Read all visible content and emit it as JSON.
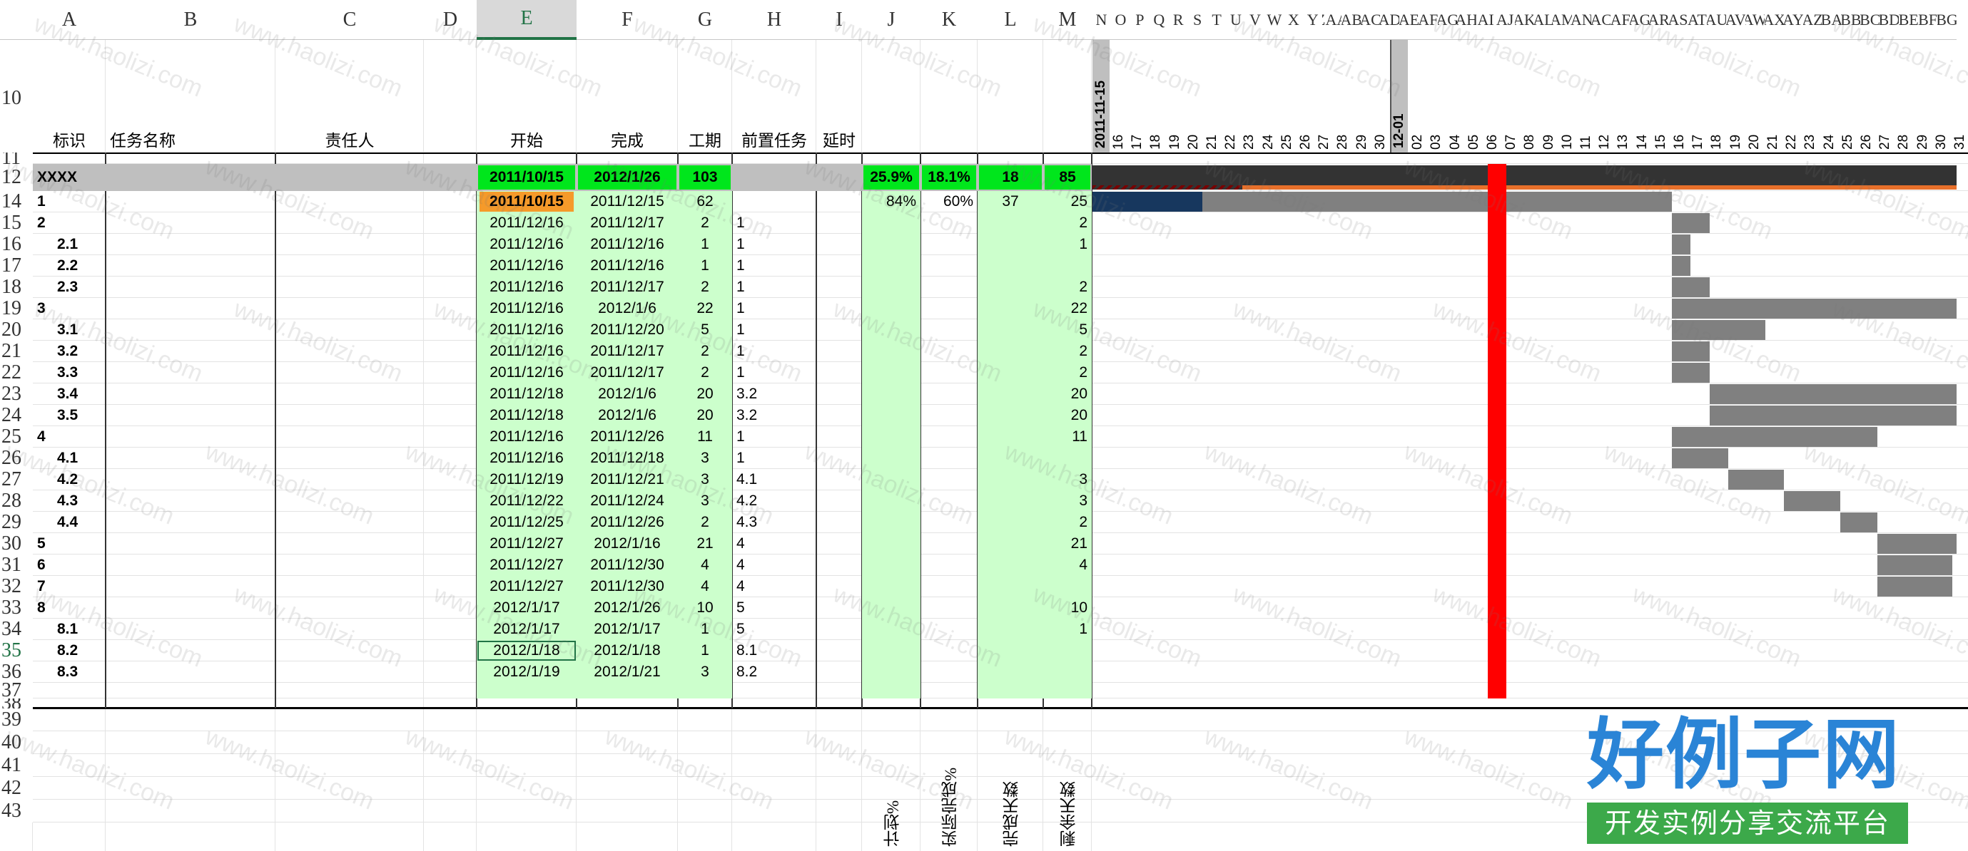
{
  "columns": [
    "A",
    "B",
    "C",
    "D",
    "E",
    "F",
    "G",
    "H",
    "I",
    "J",
    "K",
    "L",
    "M",
    "N",
    "O",
    "P",
    "Q",
    "R",
    "S",
    "T",
    "U",
    "V",
    "W",
    "X",
    "Y",
    "ZAA",
    "AB",
    "AC",
    "AD",
    "AE",
    "AF",
    "AG",
    "AH",
    "AI",
    "AJ",
    "AK",
    "AL",
    "AM",
    "AN",
    "AC",
    "AF",
    "AG",
    "AR",
    "AS",
    "AT",
    "AU",
    "AV",
    "AW",
    "AX",
    "AY",
    "AZ",
    "BA",
    "BB",
    "BC",
    "BD",
    "BE",
    "BF",
    "BG"
  ],
  "row_numbers": [
    "10",
    "11",
    "12",
    "14",
    "15",
    "16",
    "17",
    "18",
    "19",
    "20",
    "21",
    "22",
    "23",
    "24",
    "25",
    "26",
    "27",
    "28",
    "29",
    "30",
    "31",
    "32",
    "33",
    "34",
    "35",
    "36",
    "37",
    "38",
    "39",
    "40",
    "41",
    "42",
    "43"
  ],
  "headers": {
    "id": "标识",
    "name": "任务名称",
    "owner": "责任人",
    "start": "开始",
    "finish": "完成",
    "duration": "工期",
    "predecessor": "前置任务",
    "delay": "延时",
    "plan_pct": "计划%",
    "actual_pct": "实际完成%",
    "done_days": "完成天数",
    "remain_days": "剩余天数"
  },
  "timeline": {
    "date_banner_1": "2011-11-15",
    "date_banner_2": "12-01",
    "days": [
      "16",
      "17",
      "18",
      "19",
      "20",
      "21",
      "22",
      "23",
      "24",
      "25",
      "26",
      "27",
      "28",
      "29",
      "30",
      "12-01",
      "02",
      "03",
      "04",
      "05",
      "06",
      "07",
      "08",
      "09",
      "10",
      "11",
      "12",
      "13",
      "14",
      "15",
      "16",
      "17",
      "18",
      "19",
      "20",
      "21",
      "22",
      "23",
      "24",
      "25",
      "26",
      "27",
      "28",
      "29",
      "30",
      "31"
    ]
  },
  "summary": {
    "id": "XXXX",
    "start": "2011/10/15",
    "finish": "2012/1/26",
    "duration": "103",
    "plan_pct": "25.9%",
    "actual_pct": "18.1%",
    "done_days": "18",
    "remain_days": "85"
  },
  "tasks": [
    {
      "row": "14",
      "id": "1",
      "indent": false,
      "start": "2011/10/15",
      "finish": "2011/12/15",
      "duration": "62",
      "pred": "",
      "plan": "84%",
      "actual": "60%",
      "done": "37",
      "remain": "25",
      "bold_start": true
    },
    {
      "row": "15",
      "id": "2",
      "indent": false,
      "start": "2011/12/16",
      "finish": "2011/12/17",
      "duration": "2",
      "pred": "1",
      "plan": "",
      "actual": "",
      "done": "",
      "remain": "2"
    },
    {
      "row": "16",
      "id": "2.1",
      "indent": true,
      "start": "2011/12/16",
      "finish": "2011/12/16",
      "duration": "1",
      "pred": "1",
      "plan": "",
      "actual": "",
      "done": "",
      "remain": "1"
    },
    {
      "row": "17",
      "id": "2.2",
      "indent": true,
      "start": "2011/12/16",
      "finish": "2011/12/16",
      "duration": "1",
      "pred": "1",
      "plan": "",
      "actual": "",
      "done": "",
      "remain": ""
    },
    {
      "row": "18",
      "id": "2.3",
      "indent": true,
      "start": "2011/12/16",
      "finish": "2011/12/17",
      "duration": "2",
      "pred": "1",
      "plan": "",
      "actual": "",
      "done": "",
      "remain": "2"
    },
    {
      "row": "19",
      "id": "3",
      "indent": false,
      "start": "2011/12/16",
      "finish": "2012/1/6",
      "duration": "22",
      "pred": "1",
      "plan": "",
      "actual": "",
      "done": "",
      "remain": "22"
    },
    {
      "row": "20",
      "id": "3.1",
      "indent": true,
      "start": "2011/12/16",
      "finish": "2011/12/20",
      "duration": "5",
      "pred": "1",
      "plan": "",
      "actual": "",
      "done": "",
      "remain": "5"
    },
    {
      "row": "21",
      "id": "3.2",
      "indent": true,
      "start": "2011/12/16",
      "finish": "2011/12/17",
      "duration": "2",
      "pred": "1",
      "plan": "",
      "actual": "",
      "done": "",
      "remain": "2"
    },
    {
      "row": "22",
      "id": "3.3",
      "indent": true,
      "start": "2011/12/16",
      "finish": "2011/12/17",
      "duration": "2",
      "pred": "1",
      "plan": "",
      "actual": "",
      "done": "",
      "remain": "2"
    },
    {
      "row": "23",
      "id": "3.4",
      "indent": true,
      "start": "2011/12/18",
      "finish": "2012/1/6",
      "duration": "20",
      "pred": "3.2",
      "plan": "",
      "actual": "",
      "done": "",
      "remain": "20"
    },
    {
      "row": "24",
      "id": "3.5",
      "indent": true,
      "start": "2011/12/18",
      "finish": "2012/1/6",
      "duration": "20",
      "pred": "3.2",
      "plan": "",
      "actual": "",
      "done": "",
      "remain": "20"
    },
    {
      "row": "25",
      "id": "4",
      "indent": false,
      "start": "2011/12/16",
      "finish": "2011/12/26",
      "duration": "11",
      "pred": "1",
      "plan": "",
      "actual": "",
      "done": "",
      "remain": "11"
    },
    {
      "row": "26",
      "id": "4.1",
      "indent": true,
      "start": "2011/12/16",
      "finish": "2011/12/18",
      "duration": "3",
      "pred": "1",
      "plan": "",
      "actual": "",
      "done": "",
      "remain": ""
    },
    {
      "row": "27",
      "id": "4.2",
      "indent": true,
      "start": "2011/12/19",
      "finish": "2011/12/21",
      "duration": "3",
      "pred": "4.1",
      "plan": "",
      "actual": "",
      "done": "",
      "remain": "3"
    },
    {
      "row": "28",
      "id": "4.3",
      "indent": true,
      "start": "2011/12/22",
      "finish": "2011/12/24",
      "duration": "3",
      "pred": "4.2",
      "plan": "",
      "actual": "",
      "done": "",
      "remain": "3"
    },
    {
      "row": "29",
      "id": "4.4",
      "indent": true,
      "start": "2011/12/25",
      "finish": "2011/12/26",
      "duration": "2",
      "pred": "4.3",
      "plan": "",
      "actual": "",
      "done": "",
      "remain": "2"
    },
    {
      "row": "30",
      "id": "5",
      "indent": false,
      "start": "2011/12/27",
      "finish": "2012/1/16",
      "duration": "21",
      "pred": "4",
      "plan": "",
      "actual": "",
      "done": "",
      "remain": "21"
    },
    {
      "row": "31",
      "id": "6",
      "indent": false,
      "start": "2011/12/27",
      "finish": "2011/12/30",
      "duration": "4",
      "pred": "4",
      "plan": "",
      "actual": "",
      "done": "",
      "remain": "4"
    },
    {
      "row": "32",
      "id": "7",
      "indent": false,
      "start": "2011/12/27",
      "finish": "2011/12/30",
      "duration": "4",
      "pred": "4",
      "plan": "",
      "actual": "",
      "done": "",
      "remain": ""
    },
    {
      "row": "33",
      "id": "8",
      "indent": false,
      "start": "2012/1/17",
      "finish": "2012/1/26",
      "duration": "10",
      "pred": "5",
      "plan": "",
      "actual": "",
      "done": "",
      "remain": "10"
    },
    {
      "row": "34",
      "id": "8.1",
      "indent": true,
      "start": "2012/1/17",
      "finish": "2012/1/17",
      "duration": "1",
      "pred": "5",
      "plan": "",
      "actual": "",
      "done": "",
      "remain": "1"
    },
    {
      "row": "35",
      "id": "8.2",
      "indent": true,
      "start": "2012/1/18",
      "finish": "2012/1/18",
      "duration": "1",
      "pred": "8.1",
      "plan": "",
      "actual": "",
      "done": "",
      "remain": ""
    },
    {
      "row": "36",
      "id": "8.3",
      "indent": true,
      "start": "2012/1/19",
      "finish": "2012/1/21",
      "duration": "3",
      "pred": "8.2",
      "plan": "",
      "actual": "",
      "done": "",
      "remain": ""
    }
  ],
  "logo": {
    "title": "好例子网",
    "subtitle": "开发实例分享交流平台"
  },
  "watermark": "www.haolizi.com",
  "colors": {
    "green": "#00e61c",
    "light_green": "#ccffcc",
    "grey_header": "#bfbfbf",
    "orange": "#f59a2a",
    "today_line": "#ff0000",
    "gantt_bar": "#808080",
    "progress": "#17375e",
    "logo_blue": "#2a84d6",
    "logo_green": "#3ca94a"
  }
}
